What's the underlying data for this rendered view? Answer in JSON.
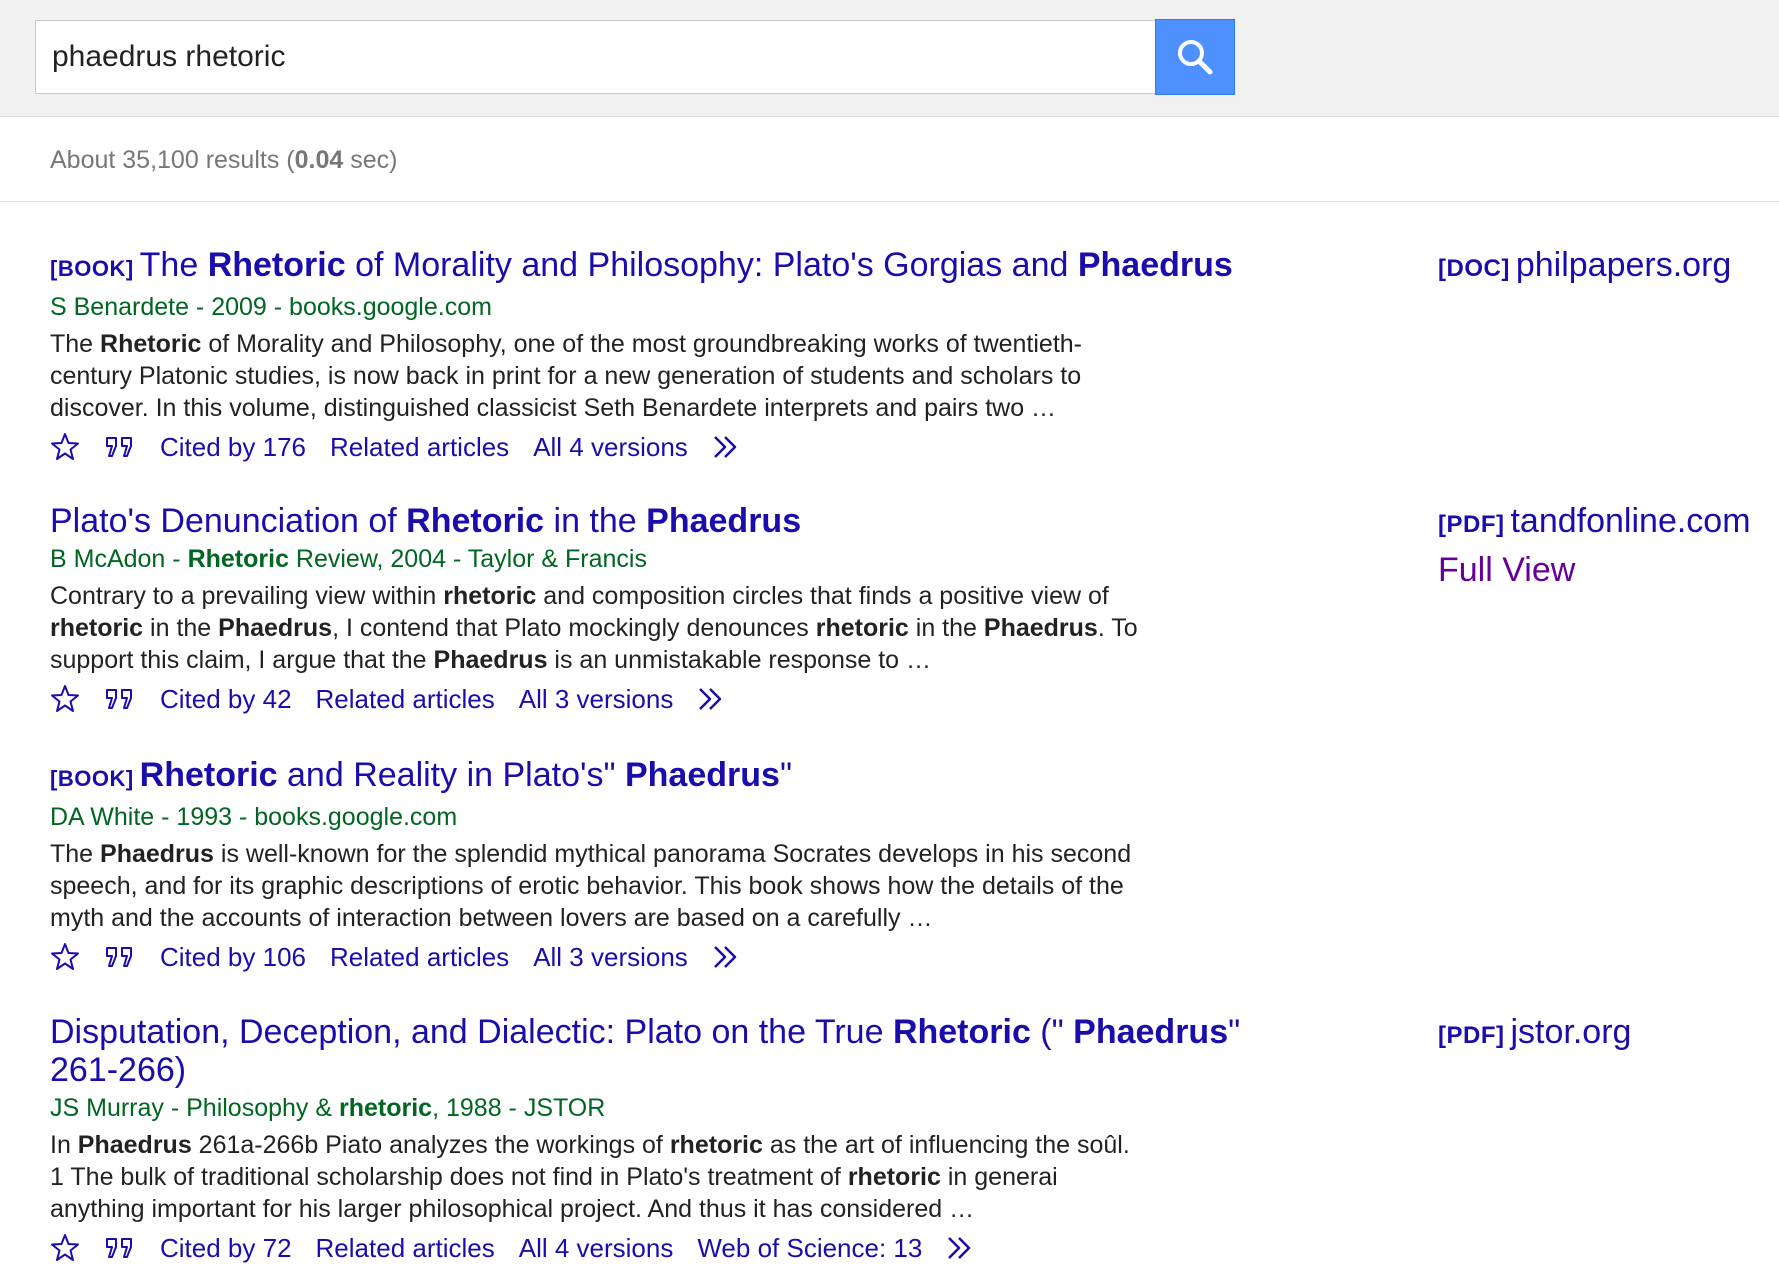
{
  "search": {
    "query": "phaedrus rhetoric"
  },
  "stats": {
    "prefix": "About 35,100 results (",
    "time": "0.04",
    "suffix": " sec)"
  },
  "results": [
    {
      "type": "[BOOK]",
      "title": [
        {
          "t": "The ",
          "b": false
        },
        {
          "t": "Rhetoric",
          "b": true
        },
        {
          "t": " of Morality and Philosophy: Plato's Gorgias and ",
          "b": false
        },
        {
          "t": "Phaedrus",
          "b": true
        }
      ],
      "meta": [
        {
          "t": "S Benardete - 2009 - books.google.com",
          "b": false
        }
      ],
      "snippet": [
        {
          "t": "The ",
          "b": false
        },
        {
          "t": "Rhetoric",
          "b": true
        },
        {
          "t": " of Morality and Philosophy, one of the most groundbreaking works of twentieth-century Platonic studies, is now back in print for a new generation of students and scholars to discover. In this volume, distinguished classicist Seth Benardete interprets and pairs two …",
          "b": false
        }
      ],
      "cited": "Cited by 176",
      "related": "Related articles",
      "versions": "All 4 versions",
      "wos": "",
      "side_type": "[DOC]",
      "side_domain": "philpapers.org",
      "side_full": ""
    },
    {
      "type": "",
      "title": [
        {
          "t": "Plato's Denunciation of ",
          "b": false
        },
        {
          "t": "Rhetoric",
          "b": true
        },
        {
          "t": " in the ",
          "b": false
        },
        {
          "t": "Phaedrus",
          "b": true
        }
      ],
      "meta": [
        {
          "t": "B McAdon - ",
          "b": false
        },
        {
          "t": "Rhetoric",
          "b": true
        },
        {
          "t": " Review, 2004 - Taylor & Francis",
          "b": false
        }
      ],
      "snippet": [
        {
          "t": "Contrary to a prevailing view within ",
          "b": false
        },
        {
          "t": "rhetoric",
          "b": true
        },
        {
          "t": " and composition circles that finds a positive view of ",
          "b": false
        },
        {
          "t": "rhetoric",
          "b": true
        },
        {
          "t": " in the ",
          "b": false
        },
        {
          "t": "Phaedrus",
          "b": true
        },
        {
          "t": ", I contend that Plato mockingly denounces ",
          "b": false
        },
        {
          "t": "rhetoric",
          "b": true
        },
        {
          "t": " in the ",
          "b": false
        },
        {
          "t": "Phaedrus",
          "b": true
        },
        {
          "t": ". To support this claim, I argue that the ",
          "b": false
        },
        {
          "t": "Phaedrus",
          "b": true
        },
        {
          "t": " is an unmistakable response to …",
          "b": false
        }
      ],
      "cited": "Cited by 42",
      "related": "Related articles",
      "versions": "All 3 versions",
      "wos": "",
      "side_type": "[PDF]",
      "side_domain": "tandfonline.com",
      "side_full": "Full View"
    },
    {
      "type": "[BOOK]",
      "title": [
        {
          "t": "Rhetoric",
          "b": true
        },
        {
          "t": " and Reality in Plato's\" ",
          "b": false
        },
        {
          "t": "Phaedrus",
          "b": true
        },
        {
          "t": "\"",
          "b": false
        }
      ],
      "meta": [
        {
          "t": "DA White - 1993 - books.google.com",
          "b": false
        }
      ],
      "snippet": [
        {
          "t": "The ",
          "b": false
        },
        {
          "t": "Phaedrus",
          "b": true
        },
        {
          "t": " is well-known for the splendid mythical panorama Socrates develops in his second speech, and for its graphic descriptions of erotic behavior. This book shows how the details of the myth and the accounts of interaction between lovers are based on a carefully …",
          "b": false
        }
      ],
      "cited": "Cited by 106",
      "related": "Related articles",
      "versions": "All 3 versions",
      "wos": "",
      "side_type": "",
      "side_domain": "",
      "side_full": ""
    },
    {
      "type": "",
      "title": [
        {
          "t": "Disputation, Deception, and Dialectic: Plato on the True ",
          "b": false
        },
        {
          "t": "Rhetoric",
          "b": true
        },
        {
          "t": " (\" ",
          "b": false
        },
        {
          "t": "Phaedrus",
          "b": true
        },
        {
          "t": "\" 261-266)",
          "b": false
        }
      ],
      "meta": [
        {
          "t": "JS Murray - Philosophy & ",
          "b": false
        },
        {
          "t": "rhetoric",
          "b": true
        },
        {
          "t": ", 1988 - JSTOR",
          "b": false
        }
      ],
      "snippet": [
        {
          "t": "In ",
          "b": false
        },
        {
          "t": "Phaedrus",
          "b": true
        },
        {
          "t": " 261a-266b Piato analyzes the workings of ",
          "b": false
        },
        {
          "t": "rhetoric",
          "b": true
        },
        {
          "t": " as the art of influencing the soûl. 1 The bulk of traditional scholarship does not find in Plato's treatment of ",
          "b": false
        },
        {
          "t": "rhetoric",
          "b": true
        },
        {
          "t": " in generai anything important for his larger philosophical project. And thus it has considered …",
          "b": false
        }
      ],
      "cited": "Cited by 72",
      "related": "Related articles",
      "versions": "All 4 versions",
      "wos": "Web of Science: 13",
      "side_type": "[PDF]",
      "side_domain": "jstor.org",
      "side_full": ""
    }
  ],
  "colors": {
    "link": "#1a0dab",
    "meta": "#006621",
    "visited": "#660099",
    "search_button": "#4d90fe"
  },
  "icons": {
    "search": "search-icon",
    "save": "star-icon",
    "cite": "quote-icon",
    "more": "double-chevron-icon"
  }
}
